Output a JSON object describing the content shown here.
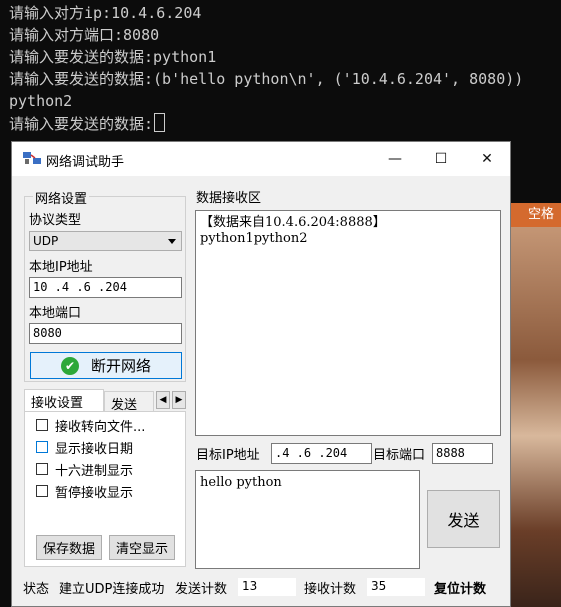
{
  "terminal": {
    "lines": [
      "请输入对方ip:10.4.6.204",
      "请输入对方端口:8080",
      "请输入要发送的数据:python1",
      "请输入要发送的数据:(b'hello python\\n', ('10.4.6.204', 8080))",
      "python2",
      "请输入要发送的数据:"
    ]
  },
  "background": {
    "strip_text": "空格"
  },
  "window": {
    "title": "网络调试助手",
    "minimize": "—",
    "maximize": "☐",
    "close": "✕"
  },
  "net_settings": {
    "group_title": "网络设置",
    "protocol_label": "协议类型",
    "protocol_value": "UDP",
    "local_ip_label": "本地IP地址",
    "local_ip_value": "10 .4  .6  .204",
    "local_port_label": "本地端口",
    "local_port_value": "8080",
    "disconnect_label": "断开网络"
  },
  "tabs": {
    "receive": "接收设置",
    "send": "发送"
  },
  "receive_settings": {
    "options": [
      "接收转向文件...",
      "显示接收日期",
      "十六进制显示",
      "暂停接收显示"
    ],
    "save_label": "保存数据",
    "clear_label": "清空显示"
  },
  "receive_area": {
    "title": "数据接收区",
    "content": "【数据来自10.4.6.204:8888】\npython1python2"
  },
  "target": {
    "ip_label": "目标IP地址",
    "ip_value": ".4  .6  .204",
    "port_label": "目标端口",
    "port_value": "8888"
  },
  "send_area": {
    "content": "hello python",
    "send_label": "发送"
  },
  "status_bar": {
    "status_label": "状态",
    "status_value": "建立UDP连接成功",
    "send_count_label": "发送计数",
    "send_count_value": "13",
    "recv_count_label": "接收计数",
    "recv_count_value": "35",
    "reset_label": "复位计数"
  },
  "colors": {
    "accent": "#0078d7",
    "connect_icon": "#2da83a",
    "terminal_bg": "#0c0c0c",
    "terminal_fg": "#cccccc"
  }
}
